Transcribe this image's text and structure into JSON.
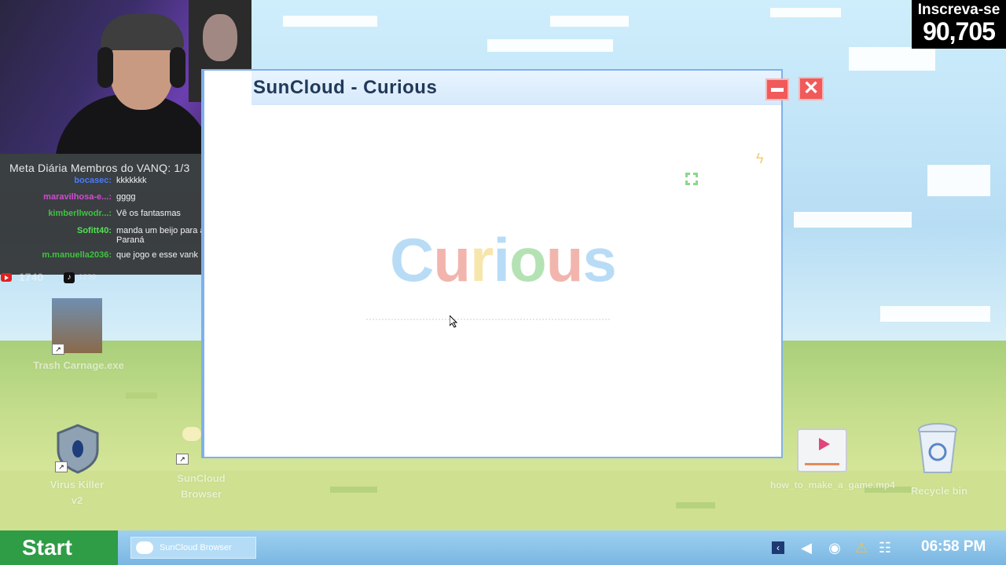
{
  "stream_overlay": {
    "subscribe": {
      "label": "Inscreva-se",
      "count": "90,705"
    },
    "chat": {
      "title": "Meta Diária Membros do VANQ: 1/3",
      "messages": [
        {
          "user": "bocasec:",
          "text": "kkkkkkk",
          "color": "#4a7bff"
        },
        {
          "user": "maravilhosa-e...:",
          "text": "gggg",
          "color": "#d24ad2"
        },
        {
          "user": "kimberllwodr...:",
          "text": "Vê os fantasmas",
          "color": "#3fc43f"
        },
        {
          "user": "Sofitt40:",
          "text": "manda um beijo para as pc Paraná",
          "color": "#55e055"
        },
        {
          "user": "m.manuella2036:",
          "text": "que jogo e esse vank",
          "color": "#3fc43f"
        }
      ],
      "social": {
        "youtube_count": "1740",
        "tiktok_count": "1230"
      }
    }
  },
  "window": {
    "title": "SunCloud - Curious",
    "minimize_icon": "minimize-icon",
    "close_icon": "close-icon",
    "logo_letters": [
      "C",
      "u",
      "r",
      "i",
      "o",
      "u",
      "s"
    ],
    "logo_colors": [
      "#7fc1ef",
      "#e97a6b",
      "#f1d36a",
      "#7fc1ef",
      "#77cc77",
      "#e97a6b",
      "#7fc1ef"
    ]
  },
  "desktop": {
    "icons": [
      {
        "label": "Trash Carnage.exe"
      },
      {
        "label": "Virus Killer v2"
      },
      {
        "label": "SunCloud Browser"
      },
      {
        "label": "how_to_make_a_game.mp4"
      },
      {
        "label": "Recycle bin"
      }
    ]
  },
  "taskbar": {
    "start_label": "Start",
    "open_app": "SunCloud Browser",
    "tray_icons": [
      "chevron-left-icon",
      "volume-icon",
      "globe-icon",
      "warning-icon",
      "network-icon"
    ],
    "clock": "06:58 PM"
  }
}
